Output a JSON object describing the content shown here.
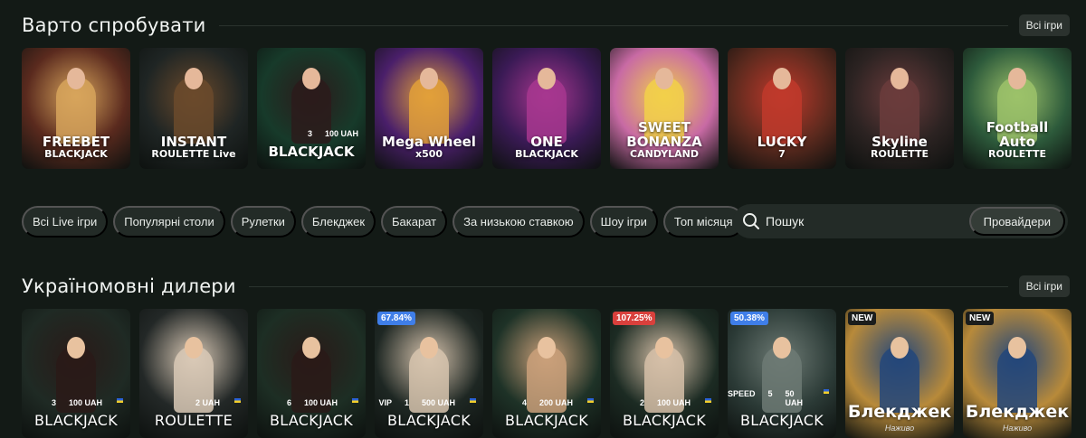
{
  "section1": {
    "title": "Варто спробувати",
    "all_label": "Всі ігри",
    "cards": [
      {
        "name": "freebet-blackjack",
        "line1": "FREEBET",
        "line2": "BLACKJACK",
        "bg": "#5a2a1e",
        "accent": "#d7a45c"
      },
      {
        "name": "instant-roulette",
        "line1": "INSTANT",
        "line2": "ROULETTE Live",
        "bg": "#1f2524",
        "accent": "#6b4a2c"
      },
      {
        "name": "blackjack-3",
        "line1": "BLACKJACK",
        "line2": "",
        "seat": "3",
        "limit": "100 UAH",
        "bg": "#173a2a",
        "accent": "#2b1b1b"
      },
      {
        "name": "mega-wheel",
        "line1": "Mega Wheel",
        "line2": "x500",
        "bg": "#4a1f6a",
        "accent": "#e2a03a"
      },
      {
        "name": "one-blackjack",
        "line1": "ONE",
        "line2": "BLACKJACK",
        "bg": "#3a1a55",
        "accent": "#a7378f"
      },
      {
        "name": "sweet-bonanza",
        "line1": "SWEET BONANZA",
        "line2": "CANDYLAND",
        "bg": "#c86aa4",
        "accent": "#f2d04a"
      },
      {
        "name": "lucky-7",
        "line1": "LUCKY",
        "line2": "7",
        "bg": "#5d2a1e",
        "accent": "#c0392b"
      },
      {
        "name": "skyline-roulette",
        "line1": "Skyline",
        "line2": "ROULETTE",
        "bg": "#2c2322",
        "accent": "#6b3c3c"
      },
      {
        "name": "football-auto-roulette",
        "line1": "Football Auto",
        "line2": "ROULETTE",
        "bg": "#2d5a3b",
        "accent": "#9cc26a"
      }
    ]
  },
  "filters": [
    "Всі Live ігри",
    "Популярні столи",
    "Рулетки",
    "Блекджек",
    "Бакарат",
    "За низькою ставкою",
    "Шоу ігри",
    "Топ місяця"
  ],
  "search": {
    "placeholder": "Пошук",
    "providers_label": "Провайдери"
  },
  "section2": {
    "title": "Україномовні дилери",
    "all_label": "Всі ігри",
    "cards": [
      {
        "name": "blackjack-3-ua",
        "line1": "BLACKJACK",
        "seat": "3",
        "limit": "100 UAH",
        "badge": "",
        "bg": "#1f2a24",
        "accent": "#2a1a18"
      },
      {
        "name": "roulette-ua",
        "line1": "ROULETTE",
        "seat": "",
        "limit": "2 UAH",
        "badge": "",
        "bg": "#232827",
        "accent": "#d9c9b6"
      },
      {
        "name": "blackjack-6-ua",
        "line1": "BLACKJACK",
        "seat": "6",
        "limit": "100 UAH",
        "badge": "",
        "bg": "#1d2e24",
        "accent": "#2a1a18"
      },
      {
        "name": "vip-blackjack-ua",
        "line1": "BLACKJACK",
        "seat": "1",
        "limit": "500 UAH",
        "prefix": "VIP",
        "badge": "67.84%",
        "badge_type": "blue",
        "bg": "#1e2723",
        "accent": "#d7c4ae"
      },
      {
        "name": "blackjack-4-ua",
        "line1": "BLACKJACK",
        "seat": "4",
        "limit": "200 UAH",
        "badge": "",
        "bg": "#1e3227",
        "accent": "#caa07a"
      },
      {
        "name": "blackjack-2-ua",
        "line1": "BLACKJACK",
        "seat": "2",
        "limit": "100 UAH",
        "badge": "107.25%",
        "badge_type": "red",
        "bg": "#1c2b23",
        "accent": "#d6c0a8"
      },
      {
        "name": "speed-blackjack-ua",
        "line1": "BLACKJACK",
        "seat": "5",
        "limit": "50 UAH",
        "prefix": "SPEED",
        "badge": "50.38%",
        "badge_type": "blue",
        "bg": "#2b3a36",
        "accent": "#6d7a74"
      },
      {
        "name": "blackjack-nazhyvo-1",
        "line1": "Блекджек",
        "sub": "Наживо",
        "badge": "NEW",
        "badge_type": "new",
        "bg": "#b88a3a",
        "accent": "#23467a"
      },
      {
        "name": "blackjack-nazhyvo-2",
        "line1": "Блекджек",
        "sub": "Наживо",
        "badge": "NEW",
        "badge_type": "new",
        "bg": "#b88a3a",
        "accent": "#23467a"
      }
    ]
  }
}
